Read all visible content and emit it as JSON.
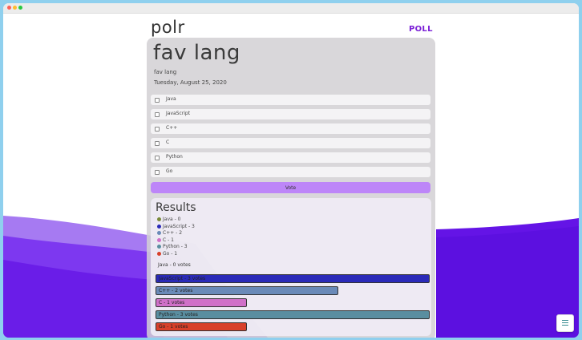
{
  "header": {
    "logo": "polr",
    "nav_label": "POLL"
  },
  "poll": {
    "title": "fav lang",
    "description": "fav lang",
    "date": "Tuesday, August 25, 2020",
    "options": [
      {
        "label": "Java"
      },
      {
        "label": "JavaScript"
      },
      {
        "label": "C++"
      },
      {
        "label": "C"
      },
      {
        "label": "Python"
      },
      {
        "label": "Go"
      }
    ],
    "vote_label": "Vote"
  },
  "results": {
    "title": "Results",
    "legend": [
      {
        "label": "Java - 0",
        "color": "#7a8a3a"
      },
      {
        "label": "JavaScript - 3",
        "color": "#2a2ab8"
      },
      {
        "label": "C++ - 2",
        "color": "#6a8ab8"
      },
      {
        "label": "C - 1",
        "color": "#d070c8"
      },
      {
        "label": "Python - 3",
        "color": "#5a8ea0"
      },
      {
        "label": "Go - 1",
        "color": "#d8402a"
      }
    ],
    "bars": [
      {
        "label": "Java - 0 votes",
        "votes": 0,
        "color": "#7a8a3a"
      },
      {
        "label": "JavaScript - 3 votes",
        "votes": 3,
        "color": "#2a2ab8"
      },
      {
        "label": "C++ - 2 votes",
        "votes": 2,
        "color": "#6a8ab8"
      },
      {
        "label": "C - 1 votes",
        "votes": 1,
        "color": "#d070c8"
      },
      {
        "label": "Python - 3 votes",
        "votes": 3,
        "color": "#5a8ea0"
      },
      {
        "label": "Go - 1 votes",
        "votes": 1,
        "color": "#d8402a"
      }
    ],
    "max_votes": 3
  },
  "fab": {
    "icon": "menu-icon"
  }
}
